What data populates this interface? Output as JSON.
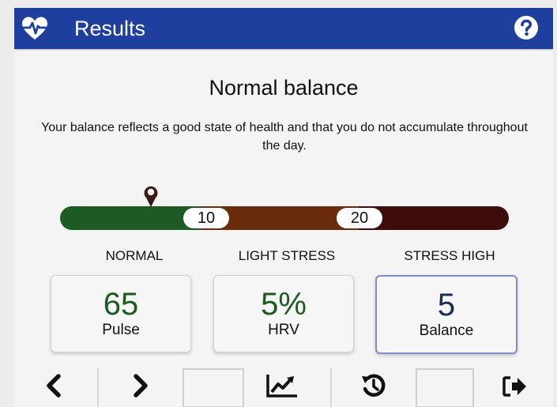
{
  "header": {
    "title": "Results",
    "app_icon": "heart-pulse-icon",
    "help_icon": "help-icon",
    "color": "#1f3f9e"
  },
  "main": {
    "heading": "Normal balance",
    "description": "Your balance reflects a good state of health and that you do not accumulate throughout the day."
  },
  "stress_scale": {
    "thresholds": [
      "10",
      "20"
    ],
    "zones": [
      {
        "label": "NORMAL",
        "color": "#1e5a23"
      },
      {
        "label": "LIGHT STRESS",
        "color": "#6a2c0c"
      },
      {
        "label": "STRESS HIGH",
        "color": "#3f0c0c"
      }
    ],
    "marker_icon": "location-pin-icon"
  },
  "metrics": [
    {
      "value": "65",
      "label": "Pulse"
    },
    {
      "value": "5%",
      "label": "HRV"
    },
    {
      "value": "5",
      "label": "Balance"
    }
  ],
  "toolbar": {
    "icons": [
      "chevron-left-icon",
      "chevron-right-icon",
      "trend-chart-icon",
      "history-icon",
      "exit-icon"
    ]
  }
}
